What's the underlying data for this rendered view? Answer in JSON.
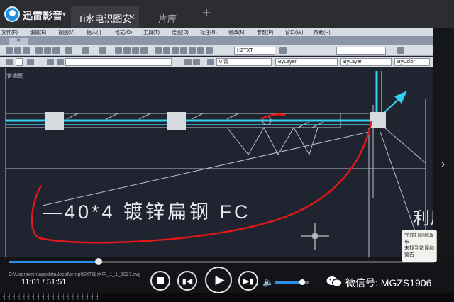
{
  "player": {
    "app_name": "迅雷影音",
    "tabs": [
      {
        "label": "Ti水电识图安",
        "active": true
      },
      {
        "label": "片库",
        "active": false
      }
    ],
    "add_tab_symbol": "+",
    "current_time": "11:01",
    "total_time": "51:51",
    "time_display": "11:01 / 51:51",
    "progress_fraction": 0.212,
    "volume_fraction": 0.8,
    "file_path": "C:\\Users\\min\\appdata\\local\\temp\\原住屋水电_1_1_1027.svg"
  },
  "watermark": {
    "text": "微信号: MGZS1906"
  },
  "popup_note": {
    "line1": "完成打印和发布",
    "line2": "未找到错误和警告"
  },
  "cad": {
    "menu": [
      "文件(F)",
      "编辑(E)",
      "视图(V)",
      "插入(I)",
      "格式(O)",
      "工具(T)",
      "绘图(D)",
      "标注(N)",
      "修改(M)",
      "参数(P)",
      "窗口(W)",
      "帮助(H)"
    ],
    "side_label": "[俯视图]",
    "text_style": "HZTXT",
    "layer_name": "0 青",
    "linetype": "ByLayer",
    "lineweight": "ByLayer",
    "color_mode": "ByColor",
    "annotation_text": "—40*4 镀锌扁钢 FC",
    "right_text": "利用"
  },
  "bottom_text": "┤ ┤ ┤ ┤ ┤ ┤ ┤ ┤ ┤ ┤ ┤ ┤ ┤ ┤ ┤ ┤ ┤ ┤ ┤ ┤",
  "colors": {
    "conductor": "#35d0f0",
    "annotation_pen": "#e01818",
    "cad_background": "#1f2430",
    "accent": "#2f8fe8"
  }
}
